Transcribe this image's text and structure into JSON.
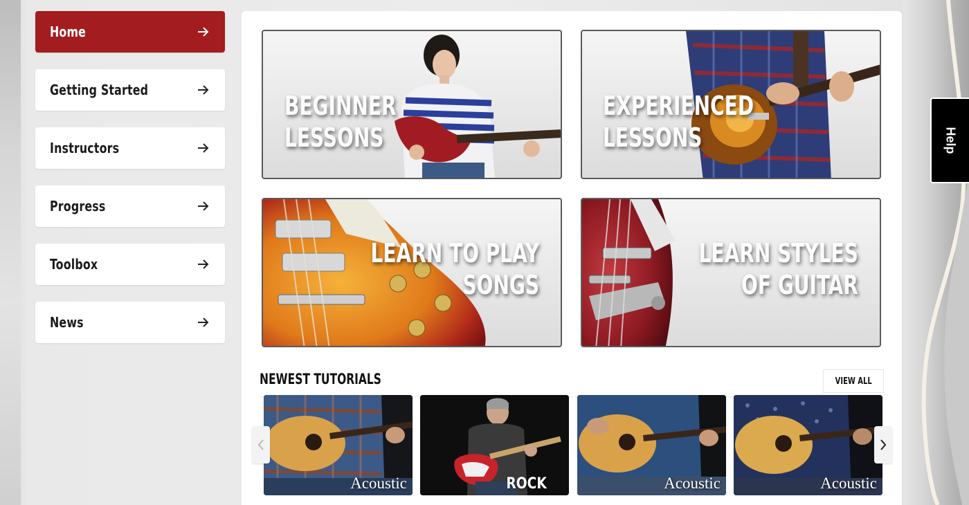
{
  "sidebar": {
    "items": [
      {
        "label": "Home",
        "active": true
      },
      {
        "label": "Getting Started"
      },
      {
        "label": "Instructors"
      },
      {
        "label": "Progress"
      },
      {
        "label": "Toolbox"
      },
      {
        "label": "News"
      }
    ]
  },
  "tiles": {
    "beginner": {
      "line1": "BEGINNER",
      "line2": "LESSONS"
    },
    "experienced": {
      "line1": "EXPERIENCED",
      "line2": "LESSONS"
    },
    "songs": {
      "line1": "LEARN TO PLAY",
      "line2": "SONGS"
    },
    "styles": {
      "line1": "LEARN STYLES",
      "line2": "OF GUITAR"
    }
  },
  "tutorials": {
    "title": "NEWEST TUTORIALS",
    "view_all": "VIEW ALL",
    "items": [
      {
        "label": "Acoustic"
      },
      {
        "label": "ROCK"
      },
      {
        "label": "Acoustic"
      },
      {
        "label": "Acoustic"
      }
    ]
  },
  "help": {
    "label": "Help"
  },
  "colors": {
    "accent": "#a31c1f",
    "panel": "#ffffff",
    "page": "#e9e9e9"
  }
}
